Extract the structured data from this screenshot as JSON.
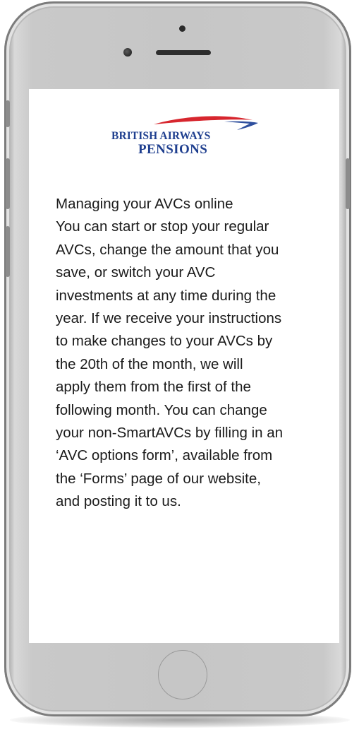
{
  "logo": {
    "line1": "BRITISH AIRWAYS",
    "line2": "PENSIONS",
    "colors": {
      "navy": "#1f3f8f",
      "red": "#d7262e",
      "blue": "#2e4f9e"
    }
  },
  "content": {
    "heading": "Managing your AVCs online",
    "body": "You can start or stop your regular\nAVCs, change the amount that you\nsave, or switch your AVC\ninvestments at any time during the\nyear. If we receive your instructions\nto make changes to your AVCs by\nthe 20th of the month, we will\napply them from the first of the\nfollowing month. You can change\nyour non-SmartAVCs by filling in an\n‘AVC options form’, available from\nthe ‘Forms’ page of our website,\nand posting it to us."
  },
  "device": {
    "frame_color": "#c6c6c6",
    "screen_color": "#ffffff"
  }
}
